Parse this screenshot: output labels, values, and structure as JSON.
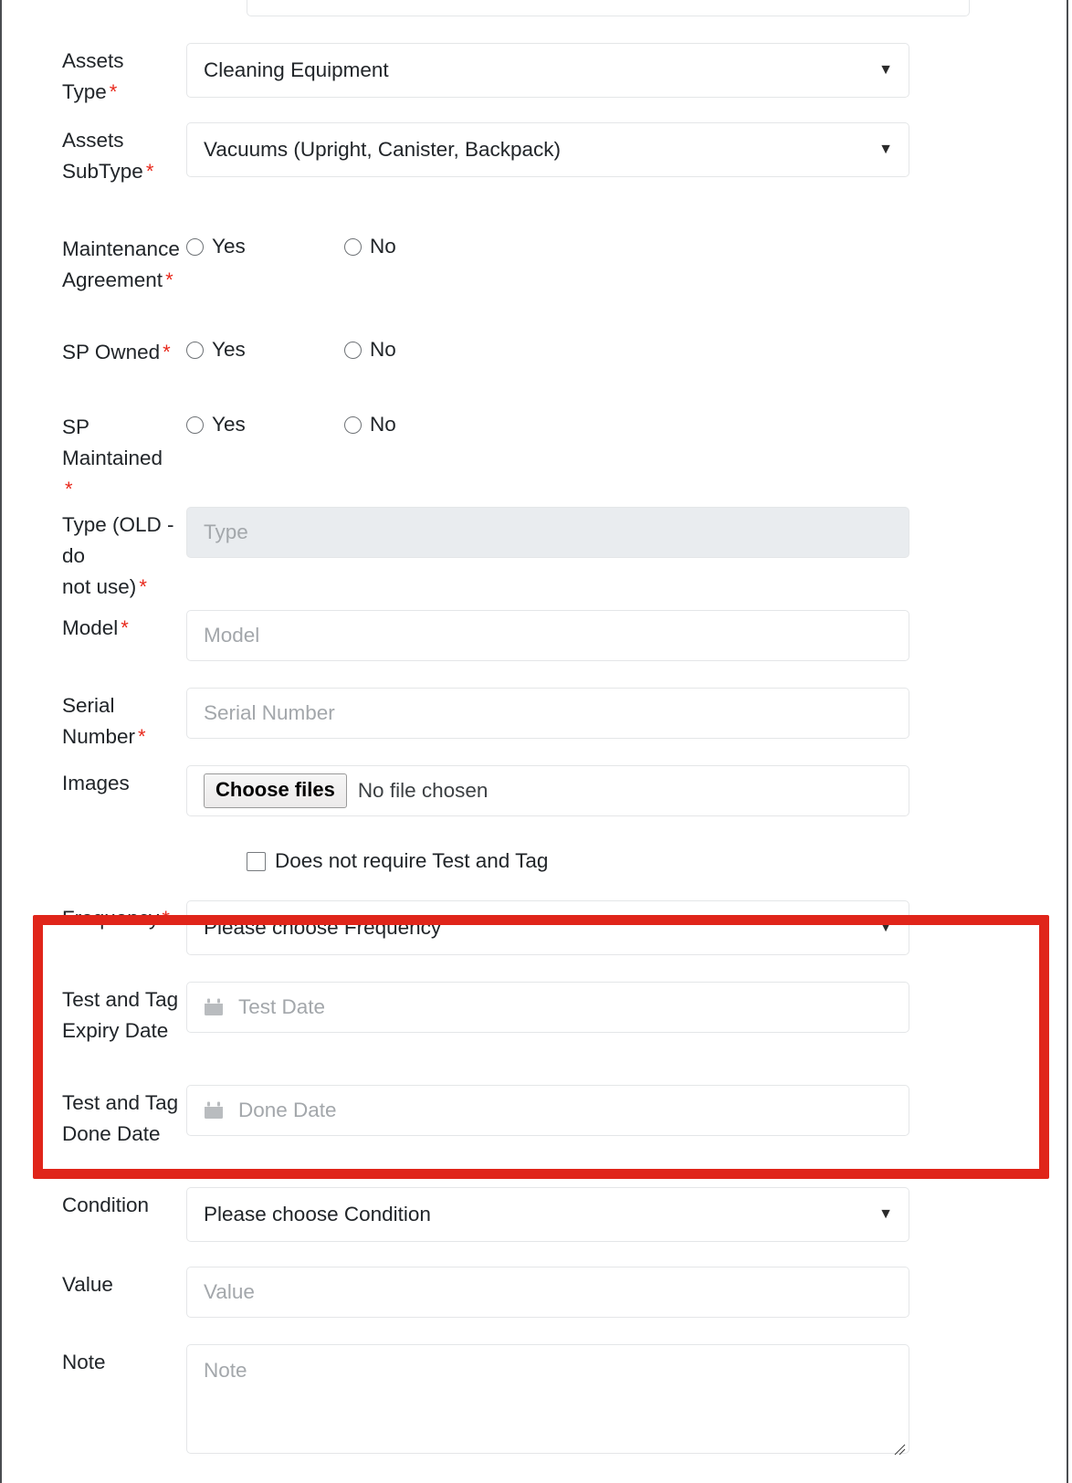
{
  "form": {
    "rows": [
      {
        "id": "assets-type",
        "label": "Assets Type",
        "required": true,
        "control": "select",
        "value": "Cleaning Equipment"
      },
      {
        "id": "assets-subtype",
        "label": "Assets SubType",
        "label_line1": "Assets",
        "label_line2": "SubType",
        "required": true,
        "control": "select",
        "value": "Vacuums (Upright, Canister, Backpack)"
      },
      {
        "id": "maintenance-agreement",
        "label": "Maintenance Agreement",
        "label_line1": "Maintenance",
        "label_line2": "Agreement",
        "required": true,
        "control": "radio",
        "options": [
          "Yes",
          "No"
        ]
      },
      {
        "id": "sp-owned",
        "label": "SP Owned",
        "required": true,
        "control": "radio",
        "options": [
          "Yes",
          "No"
        ]
      },
      {
        "id": "sp-maintained",
        "label": "SP Maintained",
        "required": true,
        "control": "radio",
        "options": [
          "Yes",
          "No"
        ]
      },
      {
        "id": "type-old",
        "label": "Type (OLD - do not use)",
        "label_line1": "Type (OLD - do",
        "label_line2": "not use)",
        "required": true,
        "control": "text-disabled",
        "placeholder": "Type"
      },
      {
        "id": "model",
        "label": "Model",
        "required": true,
        "control": "text",
        "placeholder": "Model"
      },
      {
        "id": "serial-number",
        "label": "Serial Number",
        "required": true,
        "control": "text",
        "placeholder": "Serial Number"
      },
      {
        "id": "images",
        "label": "Images",
        "required": false,
        "control": "file",
        "button_label": "Choose files",
        "status_text": "No file chosen"
      },
      {
        "id": "frequency",
        "label": "Frequency",
        "required": true,
        "control": "select",
        "value": "Please choose Frequency"
      },
      {
        "id": "test-tag-expiry",
        "label": "Test and Tag Expiry Date",
        "label_line1": "Test and Tag",
        "label_line2": "Expiry Date",
        "required": false,
        "control": "date",
        "placeholder": "Test Date"
      },
      {
        "id": "test-tag-done",
        "label": "Test and Tag Done Date",
        "label_line1": "Test and Tag",
        "label_line2": "Done Date",
        "required": false,
        "control": "date",
        "placeholder": "Done Date"
      },
      {
        "id": "condition",
        "label": "Condition",
        "required": false,
        "control": "select",
        "value": "Please choose Condition"
      },
      {
        "id": "value",
        "label": "Value",
        "required": false,
        "control": "text",
        "placeholder": "Value"
      },
      {
        "id": "note",
        "label": "Note",
        "required": false,
        "control": "textarea",
        "placeholder": "Note"
      }
    ],
    "checkbox": {
      "label": "Does not require Test and Tag",
      "checked": false
    },
    "required_marker": "*",
    "dropdown_caret": "▼"
  },
  "colors": {
    "highlight_border": "#e0251a",
    "required_asterisk": "#e8291c",
    "placeholder_text": "#a3a7ab",
    "field_border": "#e4e6e8",
    "disabled_bg": "#e9ecef",
    "text": "#212529"
  }
}
